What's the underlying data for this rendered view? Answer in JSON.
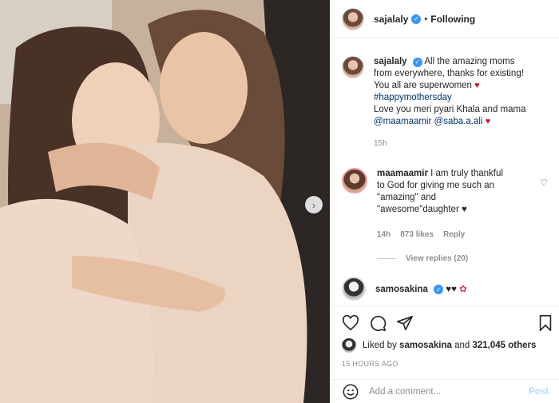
{
  "post": {
    "username": "sajalaly",
    "follow_status": "Following",
    "caption_lines": [
      "All the amazing moms",
      "from everywhere, thanks for existing!",
      "You all are superwomen",
      "#happymothersday",
      "Love you meri pyari Khala and mama",
      "@maamaamir",
      "@saba.a.ali"
    ],
    "caption_time": "15h"
  },
  "comments": [
    {
      "username": "maamaamir",
      "text_lines": [
        "I am truly thankful",
        "to God for giving me such an",
        "\"amazing\" and",
        "\"awesome\"daughter ♥"
      ],
      "time": "14h",
      "likes": "873 likes",
      "reply": "Reply",
      "view_replies": "View replies (20)"
    },
    {
      "username": "samosakina",
      "text": "♥♥"
    }
  ],
  "likes_summary": {
    "prefix": "Liked by",
    "user": "samosakina",
    "connector": "and",
    "others": "321,045 others"
  },
  "posted": "15 HOURS AGO",
  "add_comment": {
    "placeholder": "Add a comment...",
    "post_label": "Post"
  },
  "icons": {
    "verified": "verified-badge-icon",
    "like": "heart-icon",
    "comment": "comment-icon",
    "share": "paper-plane-icon",
    "save": "bookmark-icon",
    "emoji": "smiley-icon",
    "next": "chevron-right-icon"
  },
  "colors": {
    "verified": "#3897f0",
    "link": "#00376b",
    "muted": "#8e8e8e",
    "post_button": "#b3dbff"
  }
}
